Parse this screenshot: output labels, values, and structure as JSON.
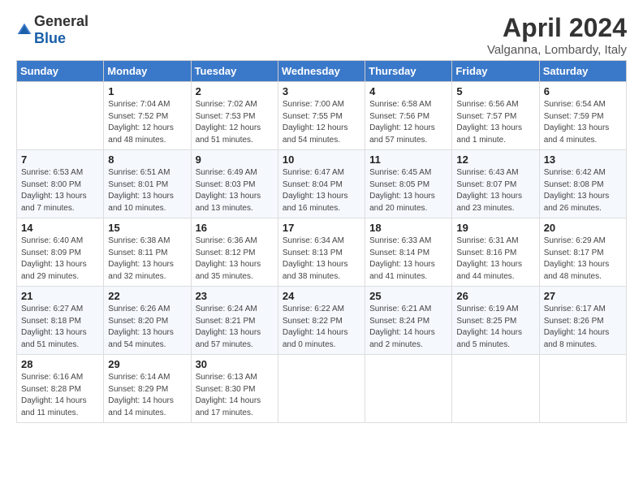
{
  "header": {
    "logo_general": "General",
    "logo_blue": "Blue",
    "title": "April 2024",
    "location": "Valganna, Lombardy, Italy"
  },
  "days_of_week": [
    "Sunday",
    "Monday",
    "Tuesday",
    "Wednesday",
    "Thursday",
    "Friday",
    "Saturday"
  ],
  "weeks": [
    [
      {
        "day": "",
        "info": ""
      },
      {
        "day": "1",
        "info": "Sunrise: 7:04 AM\nSunset: 7:52 PM\nDaylight: 12 hours\nand 48 minutes."
      },
      {
        "day": "2",
        "info": "Sunrise: 7:02 AM\nSunset: 7:53 PM\nDaylight: 12 hours\nand 51 minutes."
      },
      {
        "day": "3",
        "info": "Sunrise: 7:00 AM\nSunset: 7:55 PM\nDaylight: 12 hours\nand 54 minutes."
      },
      {
        "day": "4",
        "info": "Sunrise: 6:58 AM\nSunset: 7:56 PM\nDaylight: 12 hours\nand 57 minutes."
      },
      {
        "day": "5",
        "info": "Sunrise: 6:56 AM\nSunset: 7:57 PM\nDaylight: 13 hours\nand 1 minute."
      },
      {
        "day": "6",
        "info": "Sunrise: 6:54 AM\nSunset: 7:59 PM\nDaylight: 13 hours\nand 4 minutes."
      }
    ],
    [
      {
        "day": "7",
        "info": "Sunrise: 6:53 AM\nSunset: 8:00 PM\nDaylight: 13 hours\nand 7 minutes."
      },
      {
        "day": "8",
        "info": "Sunrise: 6:51 AM\nSunset: 8:01 PM\nDaylight: 13 hours\nand 10 minutes."
      },
      {
        "day": "9",
        "info": "Sunrise: 6:49 AM\nSunset: 8:03 PM\nDaylight: 13 hours\nand 13 minutes."
      },
      {
        "day": "10",
        "info": "Sunrise: 6:47 AM\nSunset: 8:04 PM\nDaylight: 13 hours\nand 16 minutes."
      },
      {
        "day": "11",
        "info": "Sunrise: 6:45 AM\nSunset: 8:05 PM\nDaylight: 13 hours\nand 20 minutes."
      },
      {
        "day": "12",
        "info": "Sunrise: 6:43 AM\nSunset: 8:07 PM\nDaylight: 13 hours\nand 23 minutes."
      },
      {
        "day": "13",
        "info": "Sunrise: 6:42 AM\nSunset: 8:08 PM\nDaylight: 13 hours\nand 26 minutes."
      }
    ],
    [
      {
        "day": "14",
        "info": "Sunrise: 6:40 AM\nSunset: 8:09 PM\nDaylight: 13 hours\nand 29 minutes."
      },
      {
        "day": "15",
        "info": "Sunrise: 6:38 AM\nSunset: 8:11 PM\nDaylight: 13 hours\nand 32 minutes."
      },
      {
        "day": "16",
        "info": "Sunrise: 6:36 AM\nSunset: 8:12 PM\nDaylight: 13 hours\nand 35 minutes."
      },
      {
        "day": "17",
        "info": "Sunrise: 6:34 AM\nSunset: 8:13 PM\nDaylight: 13 hours\nand 38 minutes."
      },
      {
        "day": "18",
        "info": "Sunrise: 6:33 AM\nSunset: 8:14 PM\nDaylight: 13 hours\nand 41 minutes."
      },
      {
        "day": "19",
        "info": "Sunrise: 6:31 AM\nSunset: 8:16 PM\nDaylight: 13 hours\nand 44 minutes."
      },
      {
        "day": "20",
        "info": "Sunrise: 6:29 AM\nSunset: 8:17 PM\nDaylight: 13 hours\nand 48 minutes."
      }
    ],
    [
      {
        "day": "21",
        "info": "Sunrise: 6:27 AM\nSunset: 8:18 PM\nDaylight: 13 hours\nand 51 minutes."
      },
      {
        "day": "22",
        "info": "Sunrise: 6:26 AM\nSunset: 8:20 PM\nDaylight: 13 hours\nand 54 minutes."
      },
      {
        "day": "23",
        "info": "Sunrise: 6:24 AM\nSunset: 8:21 PM\nDaylight: 13 hours\nand 57 minutes."
      },
      {
        "day": "24",
        "info": "Sunrise: 6:22 AM\nSunset: 8:22 PM\nDaylight: 14 hours\nand 0 minutes."
      },
      {
        "day": "25",
        "info": "Sunrise: 6:21 AM\nSunset: 8:24 PM\nDaylight: 14 hours\nand 2 minutes."
      },
      {
        "day": "26",
        "info": "Sunrise: 6:19 AM\nSunset: 8:25 PM\nDaylight: 14 hours\nand 5 minutes."
      },
      {
        "day": "27",
        "info": "Sunrise: 6:17 AM\nSunset: 8:26 PM\nDaylight: 14 hours\nand 8 minutes."
      }
    ],
    [
      {
        "day": "28",
        "info": "Sunrise: 6:16 AM\nSunset: 8:28 PM\nDaylight: 14 hours\nand 11 minutes."
      },
      {
        "day": "29",
        "info": "Sunrise: 6:14 AM\nSunset: 8:29 PM\nDaylight: 14 hours\nand 14 minutes."
      },
      {
        "day": "30",
        "info": "Sunrise: 6:13 AM\nSunset: 8:30 PM\nDaylight: 14 hours\nand 17 minutes."
      },
      {
        "day": "",
        "info": ""
      },
      {
        "day": "",
        "info": ""
      },
      {
        "day": "",
        "info": ""
      },
      {
        "day": "",
        "info": ""
      }
    ]
  ]
}
